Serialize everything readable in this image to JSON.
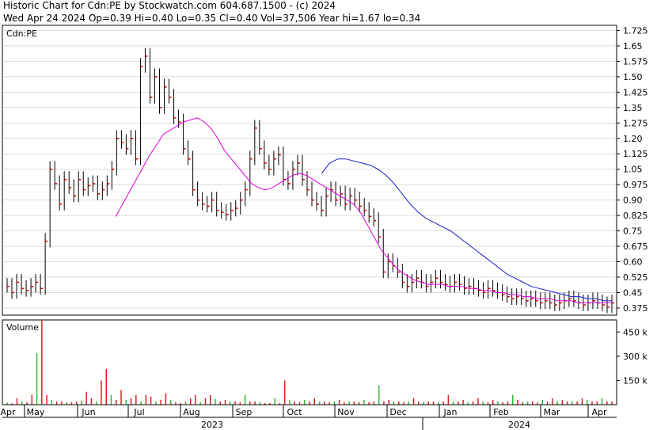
{
  "header": {
    "line1": "Historic Chart for Cdn:PE by Stockwatch.com 604.687.1500 - (c) 2024",
    "line2": "Wed Apr 24 2024  Op=0.39  Hi=0.40  Lo=0.35  Cl=0.40  Vol=37,506  Year hi=1.67  lo=0.34"
  },
  "colors": {
    "up_bar": "#000000",
    "close_tick": "#cc0000",
    "ma_short": "#e000e0",
    "ma_long": "#1a1acc",
    "vol_up": "#33bb33",
    "vol_down": "#dd2222",
    "grid": "#bbbbbb"
  },
  "chart_data": [
    {
      "type": "line",
      "title": "Cdn:PE",
      "price_ticks": [
        "1.725",
        "1.65",
        "1.575",
        "1.50",
        "1.425",
        "1.35",
        "1.275",
        "1.20",
        "1.125",
        "1.05",
        "0.975",
        "0.90",
        "0.825",
        "0.75",
        "0.675",
        "0.60",
        "0.525",
        "0.45",
        "0.375"
      ],
      "ylim": [
        0.34,
        1.75
      ],
      "month_labels": [
        "Apr",
        "May",
        "Jun",
        "Jul",
        "Aug",
        "Sep",
        "Oct",
        "Nov",
        "Dec",
        "Jan",
        "Feb",
        "Mar",
        "Apr"
      ],
      "year_labels": [
        "2023",
        "2024"
      ],
      "grid": true,
      "series": [
        {
          "name": "price_close",
          "values": [
            0.48,
            0.45,
            0.5,
            0.47,
            0.46,
            0.48,
            0.5,
            0.47,
            0.7,
            1.05,
            0.98,
            0.88,
            1.0,
            0.96,
            0.92,
            1.0,
            0.95,
            0.97,
            0.98,
            0.93,
            0.95,
            0.98,
            1.05,
            1.2,
            1.18,
            1.15,
            1.2,
            1.1,
            1.55,
            1.6,
            1.4,
            1.5,
            1.35,
            1.45,
            1.4,
            1.3,
            1.28,
            1.15,
            1.1,
            0.95,
            0.9,
            0.88,
            0.87,
            0.9,
            0.85,
            0.84,
            0.83,
            0.85,
            0.86,
            0.9,
            0.95,
            1.1,
            1.25,
            1.15,
            1.08,
            1.05,
            1.1,
            1.12,
            1.0,
            0.98,
            1.05,
            1.08,
            1.0,
            0.95,
            0.9,
            0.88,
            0.85,
            0.92,
            0.95,
            0.9,
            0.93,
            0.88,
            0.92,
            0.9,
            0.87,
            0.85,
            0.82,
            0.8,
            0.72,
            0.55,
            0.6,
            0.58,
            0.55,
            0.5,
            0.48,
            0.5,
            0.52,
            0.5,
            0.48,
            0.5,
            0.52,
            0.5,
            0.49,
            0.48,
            0.5,
            0.49,
            0.47,
            0.48,
            0.47,
            0.46,
            0.45,
            0.47,
            0.46,
            0.45,
            0.44,
            0.43,
            0.42,
            0.43,
            0.42,
            0.41,
            0.42,
            0.41,
            0.4,
            0.41,
            0.4,
            0.39,
            0.4,
            0.41,
            0.42,
            0.41,
            0.4,
            0.39,
            0.4,
            0.41,
            0.4,
            0.39,
            0.38,
            0.4
          ]
        },
        {
          "name": "ma_short",
          "values": [
            null,
            null,
            null,
            null,
            null,
            null,
            null,
            null,
            null,
            null,
            null,
            null,
            null,
            null,
            null,
            null,
            0.82,
            0.88,
            0.94,
            1.0,
            1.06,
            1.12,
            1.17,
            1.22,
            1.24,
            1.26,
            1.28,
            1.29,
            1.3,
            1.28,
            1.25,
            1.2,
            1.14,
            1.1,
            1.06,
            1.02,
            0.98,
            0.96,
            0.95,
            0.96,
            0.98,
            1.0,
            1.02,
            1.03,
            1.02,
            1.0,
            0.98,
            0.96,
            0.94,
            0.92,
            0.9,
            0.88,
            0.84,
            0.78,
            0.72,
            0.66,
            0.62,
            0.58,
            0.55,
            0.53,
            0.51,
            0.5,
            0.49,
            0.49,
            0.49,
            0.48,
            0.48,
            0.48,
            0.47,
            0.47,
            0.46,
            0.46,
            0.45,
            0.45,
            0.44,
            0.44,
            0.43,
            0.43,
            0.42,
            0.42,
            0.42,
            0.41,
            0.41,
            0.41,
            0.4,
            0.4,
            0.4,
            0.4,
            0.4,
            0.4
          ]
        },
        {
          "name": "ma_long",
          "values": [
            null,
            null,
            null,
            null,
            null,
            null,
            null,
            null,
            null,
            null,
            null,
            null,
            null,
            null,
            null,
            null,
            null,
            null,
            null,
            null,
            null,
            null,
            null,
            null,
            null,
            null,
            null,
            null,
            null,
            null,
            null,
            null,
            null,
            null,
            null,
            null,
            null,
            null,
            null,
            1.03,
            1.08,
            1.1,
            1.1,
            1.09,
            1.08,
            1.07,
            1.05,
            1.02,
            0.98,
            0.93,
            0.88,
            0.84,
            0.81,
            0.79,
            0.77,
            0.75,
            0.72,
            0.69,
            0.66,
            0.63,
            0.6,
            0.57,
            0.54,
            0.52,
            0.5,
            0.48,
            0.47,
            0.46,
            0.45,
            0.44,
            0.43,
            0.43,
            0.42,
            0.42,
            0.41,
            0.41
          ]
        }
      ]
    },
    {
      "type": "bar",
      "title": "Volume",
      "vol_ticks": [
        "450 k",
        "300 k",
        "150 k"
      ],
      "ylim": [
        0,
        525000
      ],
      "series": [
        {
          "name": "volume",
          "values": [
            12000,
            8000,
            40000,
            20000,
            15000,
            60000,
            320000,
            525000,
            60000,
            30000,
            20000,
            20000,
            15000,
            15000,
            20000,
            25000,
            80000,
            40000,
            20000,
            150000,
            220000,
            60000,
            30000,
            90000,
            30000,
            40000,
            60000,
            20000,
            60000,
            50000,
            20000,
            30000,
            70000,
            30000,
            15000,
            10000,
            20000,
            40000,
            60000,
            15000,
            40000,
            60000,
            35000,
            20000,
            30000,
            20000,
            20000,
            15000,
            60000,
            20000,
            20000,
            15000,
            10000,
            10000,
            40000,
            10000,
            150000,
            30000,
            20000,
            15000,
            30000,
            20000,
            40000,
            20000,
            20000,
            15000,
            20000,
            30000,
            15000,
            20000,
            20000,
            15000,
            30000,
            15000,
            20000,
            120000,
            20000,
            30000,
            20000,
            20000,
            15000,
            20000,
            40000,
            20000,
            15000,
            20000,
            20000,
            15000,
            20000,
            60000,
            20000,
            20000,
            30000,
            15000,
            20000,
            40000,
            20000,
            15000,
            30000,
            20000,
            15000,
            20000,
            60000,
            30000,
            15000,
            20000,
            20000,
            15000,
            30000,
            20000,
            40000,
            20000,
            30000,
            20000,
            20000,
            20000,
            40000,
            30000,
            20000,
            20000,
            40000,
            20000,
            20000
          ]
        }
      ]
    }
  ]
}
